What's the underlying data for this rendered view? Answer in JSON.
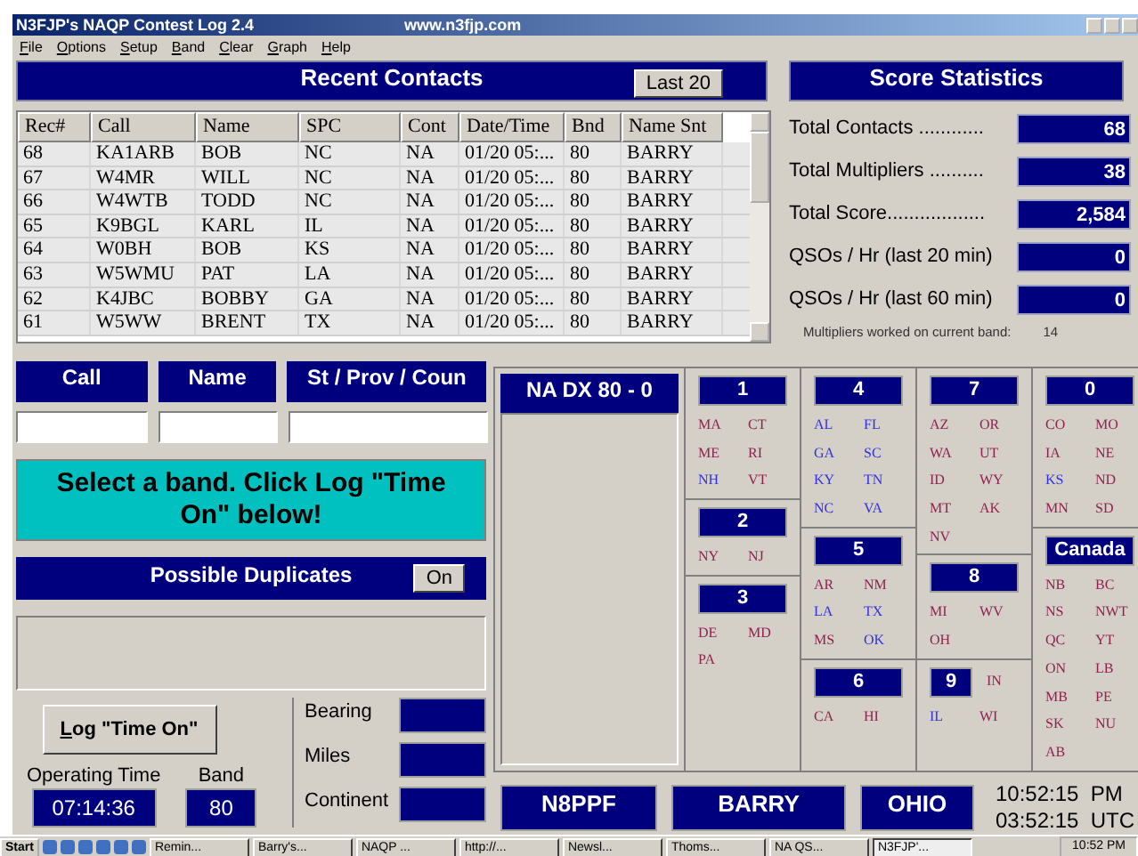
{
  "window": {
    "title": "N3FJP's NAQP Contest Log 2.4",
    "url": "www.n3fjp.com"
  },
  "menu": [
    "File",
    "Options",
    "Setup",
    "Band",
    "Clear",
    "Graph",
    "Help"
  ],
  "recent": {
    "title": "Recent Contacts",
    "button": "Last 20",
    "columns": [
      "Rec#",
      "Call",
      "Name",
      "SPC",
      "Cont",
      "Date/Time",
      "Bnd",
      "Name Snt"
    ],
    "rows": [
      [
        "68",
        "KA1ARB",
        "BOB",
        "NC",
        "NA",
        "01/20 05:...",
        "80",
        "BARRY"
      ],
      [
        "67",
        "W4MR",
        "WILL",
        "NC",
        "NA",
        "01/20 05:...",
        "80",
        "BARRY"
      ],
      [
        "66",
        "W4WTB",
        "TODD",
        "NC",
        "NA",
        "01/20 05:...",
        "80",
        "BARRY"
      ],
      [
        "65",
        "K9BGL",
        "KARL",
        "IL",
        "NA",
        "01/20 05:...",
        "80",
        "BARRY"
      ],
      [
        "64",
        "W0BH",
        "BOB",
        "KS",
        "NA",
        "01/20 05:...",
        "80",
        "BARRY"
      ],
      [
        "63",
        "W5WMU",
        "PAT",
        "LA",
        "NA",
        "01/20 05:...",
        "80",
        "BARRY"
      ],
      [
        "62",
        "K4JBC",
        "BOBBY",
        "GA",
        "NA",
        "01/20 05:...",
        "80",
        "BARRY"
      ],
      [
        "61",
        "W5WW",
        "BRENT",
        "TX",
        "NA",
        "01/20 05:...",
        "80",
        "BARRY"
      ]
    ]
  },
  "score": {
    "title": "Score Statistics",
    "stats": [
      {
        "label": "Total Contacts ............",
        "value": "68"
      },
      {
        "label": "Total Multipliers ..........",
        "value": "38"
      },
      {
        "label": "Total Score..................",
        "value": "2,584"
      },
      {
        "label": "QSOs / Hr (last 20 min)",
        "value": "0"
      },
      {
        "label": "QSOs / Hr (last 60 min)",
        "value": "0"
      }
    ],
    "band_note": "Multipliers worked on current band:",
    "band_count": "14"
  },
  "entry": {
    "fields": [
      {
        "label": "Call"
      },
      {
        "label": "Name"
      },
      {
        "label": "St / Prov / Coun"
      }
    ],
    "message": "Select a band. Click Log \"Time On\" below!",
    "duplicates": {
      "title": "Possible Duplicates",
      "button": "On"
    },
    "log_button": "Log \"Time On\"",
    "operating_time_label": "Operating Time",
    "operating_time": "07:14:36",
    "band_label": "Band",
    "band": "80",
    "info": [
      {
        "label": "Bearing"
      },
      {
        "label": "Miles"
      },
      {
        "label": "Continent"
      }
    ]
  },
  "dx": {
    "title": "NA DX 80 - 0"
  },
  "multipliers": {
    "columns": [
      {
        "zones": [
          {
            "label": "1",
            "kind": "normal",
            "states": [
              {
                "code": "MA",
                "worked": false
              },
              {
                "code": "CT",
                "worked": false
              },
              {
                "code": "ME",
                "worked": false
              },
              {
                "code": "RI",
                "worked": false
              },
              {
                "code": "NH",
                "worked": true
              },
              {
                "code": "VT",
                "worked": false
              }
            ]
          },
          {
            "label": "2",
            "kind": "normal",
            "states": [
              {
                "code": "NY",
                "worked": false
              },
              {
                "code": "NJ",
                "worked": false
              }
            ]
          },
          {
            "label": "3",
            "kind": "normal",
            "states": [
              {
                "code": "DE",
                "worked": false
              },
              {
                "code": "MD",
                "worked": false
              },
              {
                "code": "PA",
                "worked": false
              }
            ]
          }
        ]
      },
      {
        "zones": [
          {
            "label": "4",
            "kind": "normal",
            "states": [
              {
                "code": "AL",
                "worked": true
              },
              {
                "code": "FL",
                "worked": true
              },
              {
                "code": "GA",
                "worked": true
              },
              {
                "code": "SC",
                "worked": true
              },
              {
                "code": "KY",
                "worked": true
              },
              {
                "code": "TN",
                "worked": true
              },
              {
                "code": "NC",
                "worked": true
              },
              {
                "code": "VA",
                "worked": true
              }
            ]
          },
          {
            "label": "5",
            "kind": "normal",
            "states": [
              {
                "code": "AR",
                "worked": false
              },
              {
                "code": "NM",
                "worked": false
              },
              {
                "code": "LA",
                "worked": true
              },
              {
                "code": "TX",
                "worked": true
              },
              {
                "code": "MS",
                "worked": false
              },
              {
                "code": "OK",
                "worked": true
              }
            ]
          },
          {
            "label": "6",
            "kind": "normal",
            "states": [
              {
                "code": "CA",
                "worked": false
              },
              {
                "code": "HI",
                "worked": false
              }
            ]
          }
        ]
      },
      {
        "zones": [
          {
            "label": "7",
            "kind": "normal",
            "states": [
              {
                "code": "AZ",
                "worked": false
              },
              {
                "code": "OR",
                "worked": false
              },
              {
                "code": "WA",
                "worked": false
              },
              {
                "code": "UT",
                "worked": false
              },
              {
                "code": "ID",
                "worked": false
              },
              {
                "code": "WY",
                "worked": false
              },
              {
                "code": "MT",
                "worked": false
              },
              {
                "code": "AK",
                "worked": false
              },
              {
                "code": "NV",
                "worked": false
              }
            ]
          },
          {
            "label": "8",
            "kind": "normal",
            "states": [
              {
                "code": "MI",
                "worked": false
              },
              {
                "code": "WV",
                "worked": false
              },
              {
                "code": "OH",
                "worked": false
              }
            ]
          },
          {
            "label": "9",
            "kind": "compact",
            "states": [
              {
                "code": "IN",
                "worked": false
              },
              {
                "code": "IL",
                "worked": true
              },
              {
                "code": "WI",
                "worked": false
              }
            ]
          }
        ]
      },
      {
        "zones": [
          {
            "label": "0",
            "kind": "normal",
            "states": [
              {
                "code": "CO",
                "worked": false
              },
              {
                "code": "MO",
                "worked": false
              },
              {
                "code": "IA",
                "worked": false
              },
              {
                "code": "NE",
                "worked": false
              },
              {
                "code": "KS",
                "worked": true
              },
              {
                "code": "ND",
                "worked": false
              },
              {
                "code": "MN",
                "worked": false
              },
              {
                "code": "SD",
                "worked": false
              }
            ]
          },
          {
            "label": "Canada",
            "kind": "normal",
            "states": [
              {
                "code": "NB",
                "worked": false
              },
              {
                "code": "BC",
                "worked": false
              },
              {
                "code": "NS",
                "worked": false
              },
              {
                "code": "NWT",
                "worked": false
              },
              {
                "code": "QC",
                "worked": false
              },
              {
                "code": "YT",
                "worked": false
              },
              {
                "code": "ON",
                "worked": false
              },
              {
                "code": "LB",
                "worked": false
              },
              {
                "code": "MB",
                "worked": false
              },
              {
                "code": "PE",
                "worked": false
              },
              {
                "code": "SK",
                "worked": false
              },
              {
                "code": "NU",
                "worked": false
              },
              {
                "code": "AB",
                "worked": false
              }
            ]
          }
        ]
      }
    ]
  },
  "station": {
    "call": "N8PPF",
    "name": "BARRY",
    "location": "OHIO",
    "local_time": "10:52:15  PM",
    "utc_time": "03:52:15  UTC"
  },
  "taskbar": {
    "start": "Start",
    "tasks": [
      {
        "label": "Remin...",
        "selected": false
      },
      {
        "label": "Barry's...",
        "selected": false
      },
      {
        "label": "NAQP ...",
        "selected": false
      },
      {
        "label": "http://...",
        "selected": false
      },
      {
        "label": "Newsl...",
        "selected": false
      },
      {
        "label": "Thoms...",
        "selected": false
      },
      {
        "label": "NA QS...",
        "selected": false
      },
      {
        "label": "N3FJP'...",
        "selected": true
      }
    ],
    "clock": "10:52 PM"
  }
}
